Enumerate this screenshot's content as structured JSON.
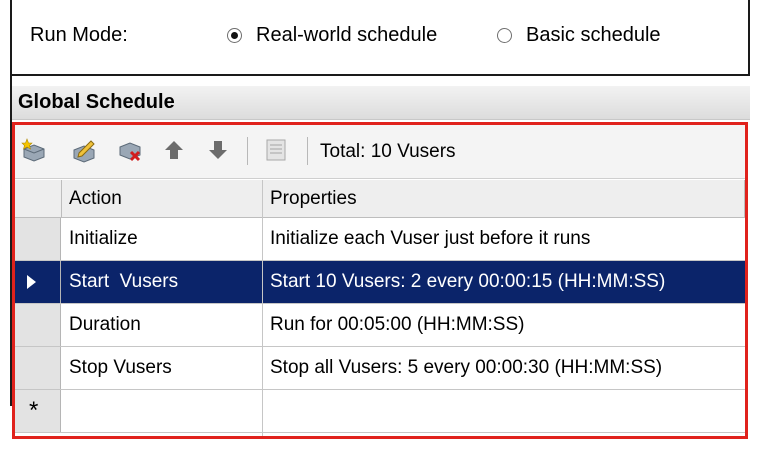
{
  "run_mode": {
    "label": "Run Mode:",
    "options": [
      {
        "label": "Real-world schedule",
        "selected": true
      },
      {
        "label": "Basic schedule",
        "selected": false
      }
    ]
  },
  "global_schedule": {
    "title": "Global Schedule",
    "toolbar": {
      "icons": [
        "new-action-icon",
        "edit-action-icon",
        "delete-action-icon",
        "move-up-icon",
        "move-down-icon",
        "properties-icon"
      ],
      "total_text": "Total: 10 Vusers"
    },
    "table": {
      "columns": [
        "Action",
        "Properties"
      ],
      "rows": [
        {
          "action": "Initialize",
          "properties": "Initialize each Vuser just before it runs",
          "selected": false
        },
        {
          "action": "Start  Vusers",
          "properties": "Start 10 Vusers: 2 every 00:00:15 (HH:MM:SS)",
          "selected": true
        },
        {
          "action": "Duration",
          "properties": "Run for 00:05:00 (HH:MM:SS)",
          "selected": false
        },
        {
          "action": "Stop Vusers",
          "properties": "Stop all Vusers: 5 every 00:00:30 (HH:MM:SS)",
          "selected": false
        }
      ],
      "new_row_marker": "*"
    }
  },
  "colors": {
    "selection": "#0b246a",
    "highlight_frame": "#e0221c"
  }
}
